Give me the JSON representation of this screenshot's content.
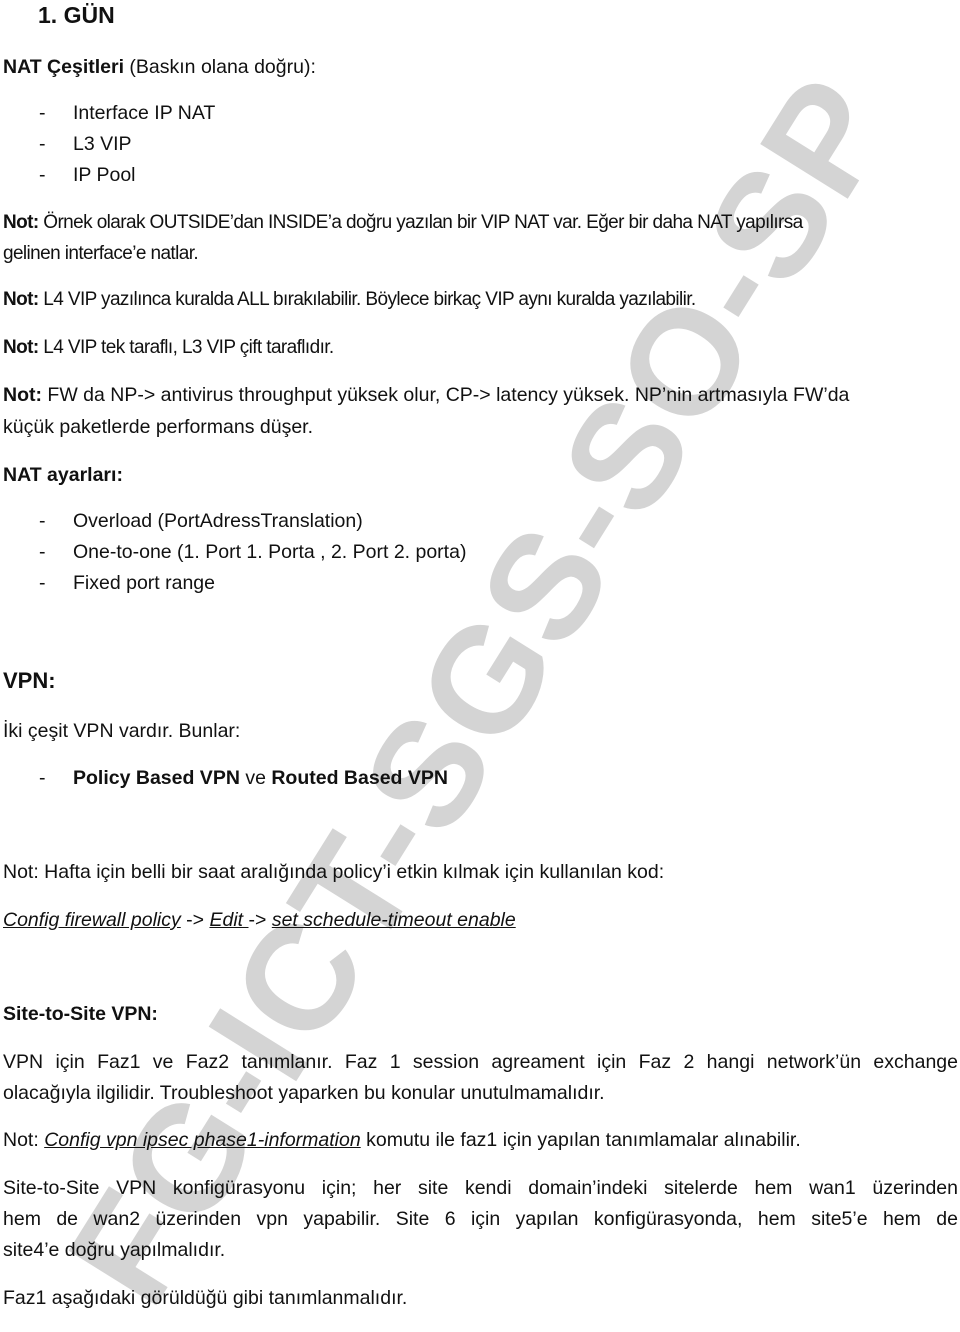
{
  "watermark": "FG-ICT-SGS-SO-SP",
  "title": "1.  GÜN",
  "nat_types": {
    "heading_bold": "NAT Çeşitleri",
    "heading_rest": " (Baskın olana doğru):",
    "items": [
      "Interface IP NAT",
      "L3 VIP",
      "IP Pool"
    ]
  },
  "notes": [
    {
      "label": "Not:",
      "lines": [
        "Örnek olarak OUTSIDE’dan INSIDE’a doğru yazılan bir VIP NAT var. Eğer bir daha NAT yapılırsa",
        "gelinen interface’e natlar."
      ]
    },
    {
      "label": "Not:",
      "lines": [
        "L4 VIP yazılınca kuralda ALL bırakılabilir. Böylece birkaç VIP aynı kuralda yazılabilir."
      ]
    },
    {
      "label": "Not:",
      "lines": [
        "L4 VIP tek taraflı, L3 VIP çift taraflıdır."
      ]
    },
    {
      "label": "Not:",
      "lines": [
        "FW da NP-> antivirus throughput yüksek olur, CP-> latency yüksek. NP’nin artmasıyla FW’da",
        "küçük paketlerde performans düşer."
      ]
    }
  ],
  "nat_settings": {
    "heading": "NAT ayarları:",
    "items": [
      "Overload (PortAdressTranslation)",
      "One-to-one (1. Port 1. Porta , 2. Port 2. porta)",
      "Fixed port range"
    ]
  },
  "vpn": {
    "heading": "VPN:",
    "intro": "İki çeşit VPN vardır. Bunlar:",
    "item": {
      "bold1": "Policy Based VPN",
      "mid": " ve ",
      "bold2": "Routed Based VPN"
    },
    "note": "Not: Hafta için belli bir saat aralığında policy’i etkin kılmak için kullanılan kod:",
    "command": {
      "part1": "Config firewall policy",
      "sep1": " -> ",
      "part2": "Edit ",
      "sep2": "-> ",
      "part3": "set schedule-timeout enable"
    }
  },
  "site_to_site": {
    "heading": "Site-to-Site VPN:",
    "para1": [
      "VPN için Faz1 ve Faz2 tanımlanır. Faz 1 session agreament için Faz 2 hangi network’ün exchange",
      "olacağıyla ilgilidir. Troubleshoot yaparken bu konular unutulmamalıdır."
    ],
    "note_prefix": "Not: ",
    "note_command": "Config vpn ipsec phase1-information",
    "note_rest": " komutu ile faz1 için yapılan tanımlamalar alınabilir.",
    "para2": [
      "Site-to-Site VPN konfigürasyonu için; her site kendi domain’indeki sitelerde hem wan1 üzerinden",
      "hem de wan2 üzerinden vpn yapabilir. Site 6 için yapılan konfigürasyonda, hem site5’e hem de",
      "site4’e doğru yapılmalıdır."
    ],
    "para3": "Faz1 aşağıdaki görüldüğü gibi tanımlanmalıdır."
  }
}
